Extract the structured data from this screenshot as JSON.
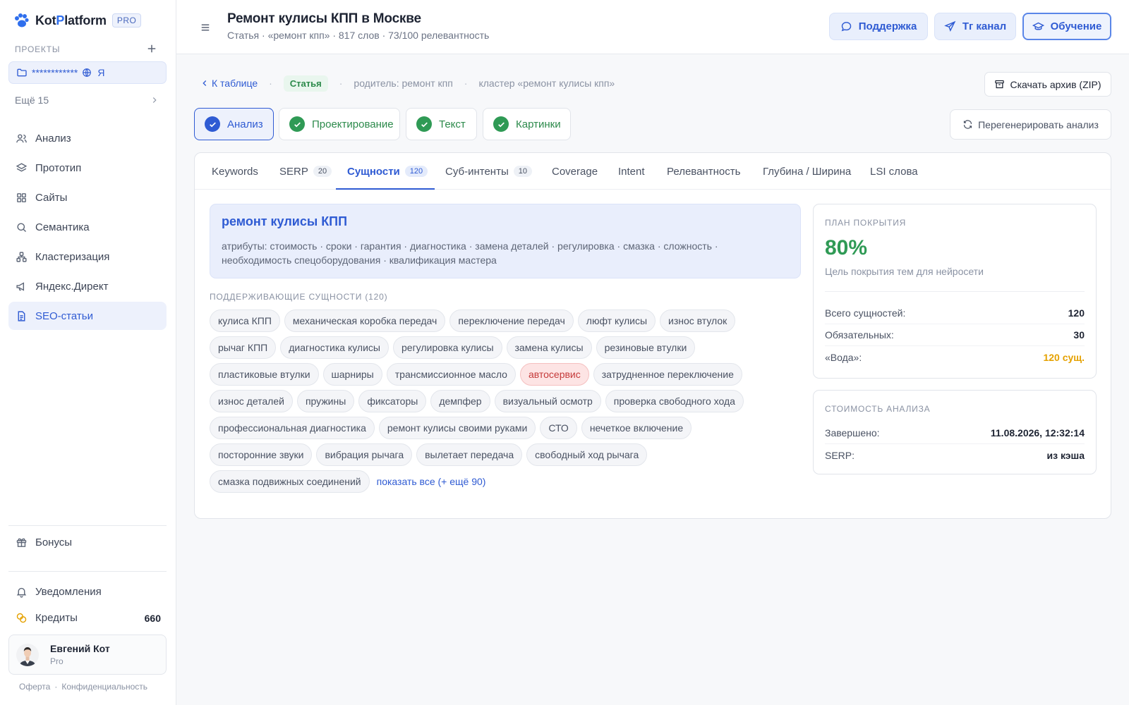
{
  "brand": {
    "name_main": "Kot",
    "name_accent": "P",
    "name_rest": "latform",
    "badge": "PRO"
  },
  "sidebar": {
    "projects_label": "ПРОЕКТЫ",
    "project_name": "************",
    "project_suffix": "Я",
    "more_label": "Ещё 15",
    "nav": [
      {
        "label": "Анализ",
        "icon": "users-icon"
      },
      {
        "label": "Прототип",
        "icon": "layers-icon"
      },
      {
        "label": "Сайты",
        "icon": "grid-icon"
      },
      {
        "label": "Семантика",
        "icon": "search-icon"
      },
      {
        "label": "Кластеризация",
        "icon": "cluster-icon"
      },
      {
        "label": "Яндекс.Директ",
        "icon": "megaphone-icon"
      },
      {
        "label": "SEO-статьи",
        "icon": "document-icon",
        "active": true
      }
    ],
    "bonus_label": "Бонусы",
    "notifications_label": "Уведомления",
    "credits_label": "Кредиты",
    "credits_value": "660",
    "user": {
      "name": "Евгений Кот",
      "role": "Pro"
    },
    "footer": {
      "offer": "Оферта",
      "privacy": "Конфиденциальность",
      "sep": "·"
    }
  },
  "header": {
    "title": "Ремонт кулисы КПП в Москве",
    "subtitle": "Статья · «ремонт кпп» · 817 слов · 73/100 релевантность",
    "buttons": {
      "support": "Поддержка",
      "tg": "Тг канал",
      "learning": "Обучение"
    }
  },
  "breadcrumbs": {
    "back": "К таблице",
    "tag": "Статья",
    "parent": "родитель: ремонт кпп",
    "cluster": "кластер «ремонт кулисы кпп»",
    "sep": "·"
  },
  "download_label": "Скачать архив (ZIP)",
  "steps": [
    {
      "label": "Анализ",
      "active": true
    },
    {
      "label": "Проектирование"
    },
    {
      "label": "Текст"
    },
    {
      "label": "Картинки"
    }
  ],
  "regen_label": "Перегенерировать анализ",
  "tabs": [
    {
      "label": "Keywords"
    },
    {
      "label": "SERP",
      "count": "20"
    },
    {
      "label": "Сущности",
      "count": "120",
      "active": true
    },
    {
      "label": "Суб-интенты",
      "count": "10"
    },
    {
      "label": "Coverage"
    },
    {
      "label": "Intent"
    },
    {
      "label": "Релевантность"
    },
    {
      "label": "Глубина / Ширина"
    },
    {
      "label": "LSI слова"
    }
  ],
  "main_entity": {
    "title": "ремонт кулисы КПП",
    "attributes": "атрибуты: стоимость · сроки · гарантия · диагностика · замена деталей · регулировка · смазка · сложность · необходимость спецоборудования · квалификация мастера"
  },
  "supporting": {
    "label": "ПОДДЕРЖИВАЮЩИЕ СУЩНОСТИ (120)",
    "chips": [
      {
        "text": "кулиса КПП"
      },
      {
        "text": "механическая коробка передач"
      },
      {
        "text": "переключение передач"
      },
      {
        "text": "люфт кулисы"
      },
      {
        "text": "износ втулок"
      },
      {
        "text": "рычаг КПП"
      },
      {
        "text": "диагностика кулисы"
      },
      {
        "text": "регулировка кулисы"
      },
      {
        "text": "замена кулисы"
      },
      {
        "text": "резиновые втулки"
      },
      {
        "text": "пластиковые втулки"
      },
      {
        "text": "шарниры"
      },
      {
        "text": "трансмиссионное масло"
      },
      {
        "text": "автосервис",
        "highlight": true
      },
      {
        "text": "затрудненное переключение"
      },
      {
        "text": "износ деталей"
      },
      {
        "text": "пружины"
      },
      {
        "text": "фиксаторы"
      },
      {
        "text": "демпфер"
      },
      {
        "text": "визуальный осмотр"
      },
      {
        "text": "проверка свободного хода"
      },
      {
        "text": "профессиональная диагностика"
      },
      {
        "text": "ремонт кулисы своими руками"
      },
      {
        "text": "СТО"
      },
      {
        "text": "нечеткое включение"
      },
      {
        "text": "посторонние звуки"
      },
      {
        "text": "вибрация рычага"
      },
      {
        "text": "вылетает передача"
      },
      {
        "text": "свободный ход рычага"
      },
      {
        "text": "смазка подвижных соединений"
      }
    ],
    "show_all": "показать все (+ ещё 90)"
  },
  "coverage": {
    "label": "ПЛАН ПОКРЫТИЯ",
    "percent": "80%",
    "desc": "Цель покрытия тем для нейросети",
    "rows": [
      {
        "k": "Всего сущностей:",
        "v": "120"
      },
      {
        "k": "Обязательных:",
        "v": "30"
      },
      {
        "k": "«Вода»:",
        "v": "120 сущ.",
        "warn": true
      }
    ]
  },
  "cost": {
    "label": "СТОИМОСТЬ АНАЛИЗА",
    "rows": [
      {
        "k": "Завершено:",
        "v": "11.08.2026, 12:32:14"
      },
      {
        "k": "SERP:",
        "v": "из кэша"
      }
    ]
  },
  "colors": {
    "accent": "#2f5bd3",
    "success": "#2f9a55",
    "warn": "#e5a100",
    "danger": "#c53a3a"
  }
}
